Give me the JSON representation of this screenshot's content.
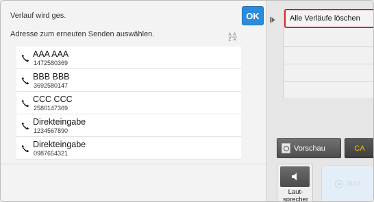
{
  "dialog": {
    "status": "Verlauf wird ges.",
    "ok_label": "OK",
    "instruction": "Adresse zum erneuten Senden auswählen.",
    "sort_icon": "sort-az-icon"
  },
  "history": [
    {
      "name": "AAA AAA",
      "number": "1472580369",
      "icon": "phone-icon"
    },
    {
      "name": "BBB BBB",
      "number": "3692580147",
      "icon": "phone-icon"
    },
    {
      "name": "CCC CCC",
      "number": "2580147369",
      "icon": "phone-icon"
    },
    {
      "name": "Direkteingabe",
      "number": "1234567890",
      "icon": "phone-icon"
    },
    {
      "name": "Direkteingabe",
      "number": "0987654321",
      "icon": "phone-icon"
    }
  ],
  "action_panel": {
    "clear_all_label": "Alle Verläufe löschen",
    "preview_label": "Vorschau",
    "ca_label": "CA",
    "speaker_label_line1": "Laut-",
    "speaker_label_line2": "sprecher",
    "start_label": "Start"
  },
  "colors": {
    "ok_button": "#2e8bd9",
    "highlight_border": "#d8202a",
    "ca_text": "#f2c200"
  }
}
